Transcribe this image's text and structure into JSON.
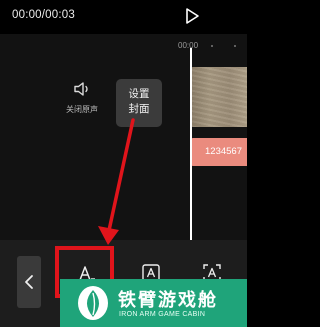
{
  "player": {
    "time": "00:00/00:03",
    "play_icon": "play-icon"
  },
  "timeline": {
    "ruler_label": "00:00",
    "mute_icon": "speaker-icon",
    "mute_label": "关闭原声",
    "cover_button_line1": "设置",
    "cover_button_line2": "封面",
    "text_track_label": "1234567"
  },
  "annotation": {
    "color": "#e0141b"
  },
  "toolbar": {
    "back_icon": "chevron-left-icon",
    "tools": [
      "text-icon",
      "text-template-icon",
      "auto-caption-icon"
    ]
  },
  "watermark": {
    "title": "铁臂游戏舱",
    "subtitle": "IRON ARM GAME CABIN",
    "color": "#1fa47a"
  }
}
